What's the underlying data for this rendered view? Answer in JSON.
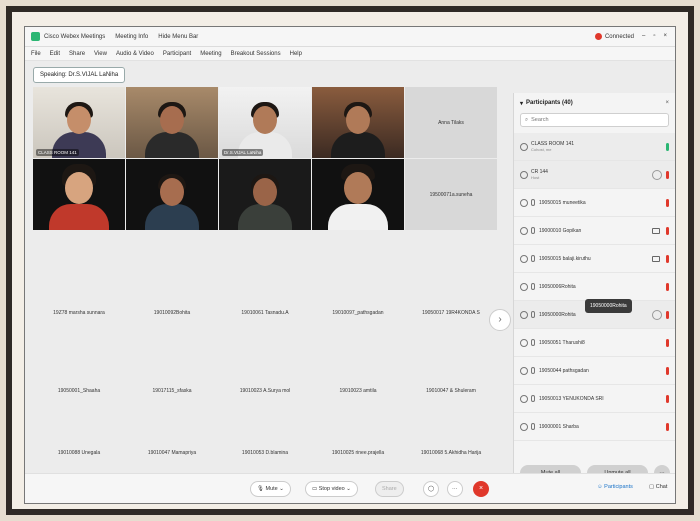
{
  "titlebar": {
    "app_name": "Cisco Webex Meetings",
    "meeting_info": "Meeting Info",
    "hide_menu": "Hide Menu Bar",
    "connected": "Connected"
  },
  "menu": [
    "File",
    "Edit",
    "Share",
    "View",
    "Audio & Video",
    "Participant",
    "Meeting",
    "Breakout Sessions",
    "Help"
  ],
  "speaking": "Speaking: Dr.S.VIJAL LaNiha",
  "videos": [
    {
      "label": "CLASS ROOM 141"
    },
    {
      "label": ""
    },
    {
      "label": "Dr.S.VIJAL LaNiha"
    },
    {
      "label": ""
    },
    {
      "label": ""
    },
    {
      "label": ""
    },
    {
      "label": ""
    },
    {
      "label": ""
    }
  ],
  "tiles": [
    "Anna Tilaks",
    "19500071a.suneha",
    "19Z78 marsha sunnara",
    "19010092Bohita",
    "19010061 Tasnadu.A",
    "19010097_pathsgadan",
    "19050017 19R4KONDA S",
    "19050001_Shaaha",
    "19017115_sfaska",
    "19010023 A.Surya mol",
    "19010023 amtila",
    "19010047 & Shuleram",
    "19010088 Unegala",
    "19010047 Mamapriya",
    "19010053 D.blamina",
    "19010025 rinee.prajella",
    "19010068 5.Akhidha Harija"
  ],
  "panel": {
    "title": "Participants (40)",
    "search_placeholder": "Search",
    "participants": [
      {
        "name": "CLASS ROOM 141",
        "sub": "Cohost, me"
      },
      {
        "name": "CR 144",
        "sub": "Host"
      },
      {
        "name": "19050015 muneetika",
        "sub": ""
      },
      {
        "name": "19000010 Gopikan",
        "sub": ""
      },
      {
        "name": "19050015 balaji.kiruthu",
        "sub": ""
      },
      {
        "name": "19050006Rohita",
        "sub": ""
      },
      {
        "name": "19050000Rohita",
        "sub": ""
      },
      {
        "name": "19050051 Tharushi8",
        "sub": ""
      },
      {
        "name": "19050044 pathsgadan",
        "sub": ""
      },
      {
        "name": "19050013 YENUKONDA SRI",
        "sub": ""
      },
      {
        "name": "19000001 Sharba",
        "sub": ""
      }
    ],
    "tooltip": "19050000Rohita",
    "mute_all": "Mute all",
    "unmute_all": "Unmute all"
  },
  "bottombar": {
    "mute": "Mute",
    "stop_video": "Stop video",
    "share": "Share",
    "participants": "Participants",
    "chat": "Chat"
  },
  "colors": {
    "end_red": "#e0382b",
    "active_blue": "#4fb6d8",
    "brand_green": "#2bb673"
  }
}
